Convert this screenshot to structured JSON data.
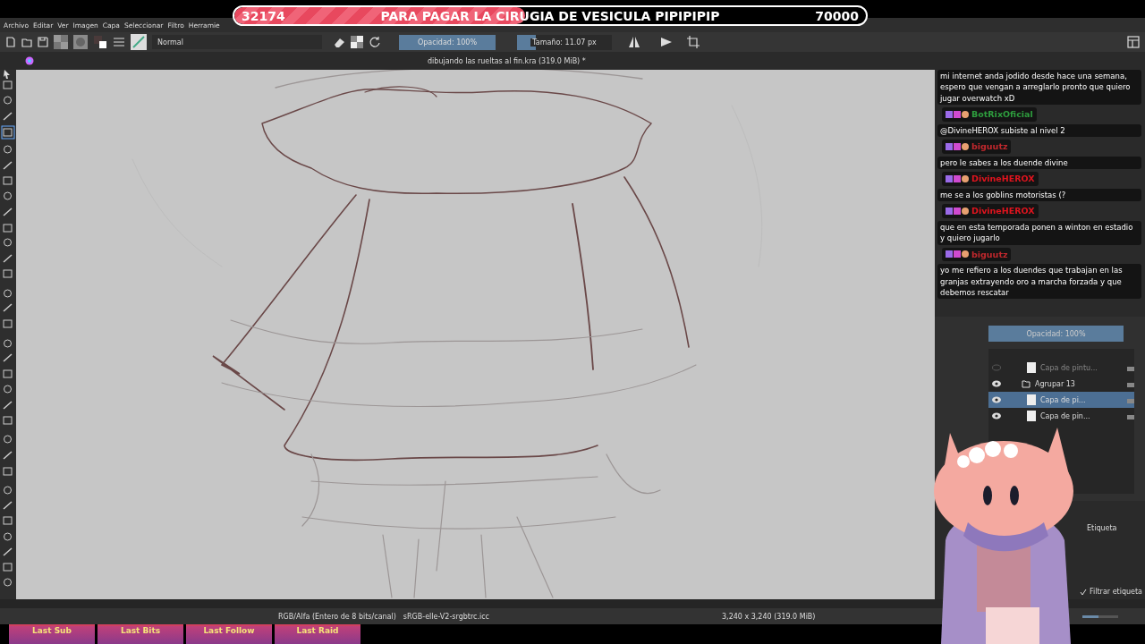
{
  "goal_banner": {
    "current": "32174",
    "title": "PARA PAGAR LA CIRUGIA DE VESICULA PIPIPIPIP",
    "target": "70000",
    "level": 0.46
  },
  "menu": [
    "Archivo",
    "Editar",
    "Ver",
    "Imagen",
    "Capa",
    "Seleccionar",
    "Filtro",
    "Herramie"
  ],
  "toolbar": {
    "blend_mode": "Normal",
    "opacity": {
      "label": "Opacidad: 100%",
      "level": 1
    },
    "size": {
      "label": "Tamaño: 11.07 px",
      "level": 0.2
    }
  },
  "document_title": "dibujando las rueltas al fin.kra (319.0 MiB) *",
  "chat": [
    {
      "text": "mi internet anda jodido desde hace una semana, espero que vengan a arreglarlo pronto que quiero jugar overwatch xD"
    },
    {
      "user": "BotRixOficial",
      "color": "#2e9e3e",
      "text": "@DivineHEROX subiste al nivel 2"
    },
    {
      "user": "biguutz",
      "color": "#c0282d",
      "text": "pero le sabes a los duende divine"
    },
    {
      "user": "DivineHEROX",
      "color": "#e0141e",
      "text": "me se a los goblins motoristas (?"
    },
    {
      "user": "DivineHEROX",
      "color": "#e0141e",
      "text": "que en esta temporada ponen a winton en estadio y quiero jugarlo"
    },
    {
      "user": "biguutz",
      "color": "#c0282d",
      "text": "yo me refiero a los duendes que trabajan en las granjas extrayendo oro a marcha forzada y que debemos rescatar"
    }
  ],
  "layers": {
    "opacity": {
      "label": "Opacidad: 100%",
      "level": 1
    },
    "items": [
      {
        "name": "Capa de pintu...",
        "visible": false,
        "selected": false,
        "kind": "paint"
      },
      {
        "name": "Agrupar 13",
        "visible": true,
        "selected": false,
        "kind": "group"
      },
      {
        "name": "Capa de pi...",
        "visible": true,
        "selected": true,
        "kind": "paint"
      },
      {
        "name": "Capa de pin...",
        "visible": true,
        "selected": false,
        "kind": "paint"
      }
    ]
  },
  "brushes": {
    "tag": "Etiqueta",
    "filter": {
      "label": "Filtrar etiqueta",
      "checked": true
    }
  },
  "status": {
    "color_space": "RGB/Alfa (Entero de 8 bits/canal)",
    "profile": "sRGB-elle-V2-srgbtrc.icc",
    "size": "3,240 x 3,240 (319.0 MiB)",
    "zoom_slider": {
      "level": 0.45
    }
  },
  "alerts": [
    "Last Sub",
    "Last Bits",
    "Last Follow",
    "Last Raid"
  ]
}
